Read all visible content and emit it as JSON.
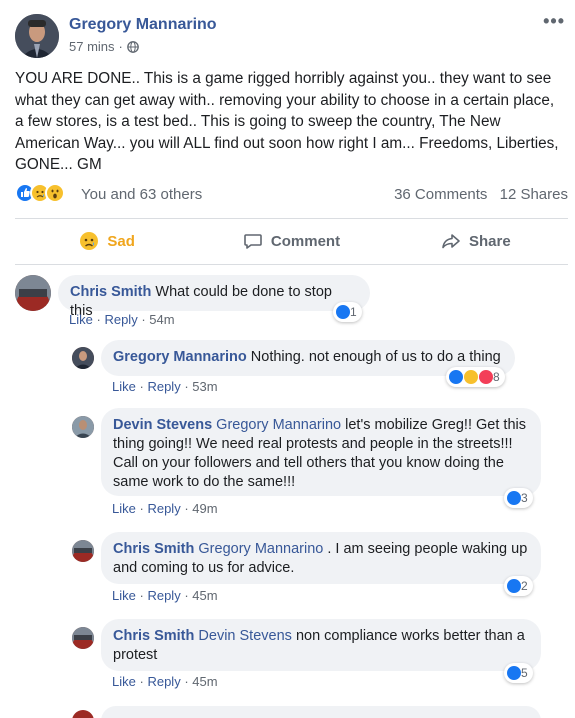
{
  "post": {
    "author": "Gregory Mannarino",
    "time": "57 mins",
    "meta_dot": "·",
    "more": "•••",
    "text": "YOU ARE DONE.. This is a game rigged horribly against you.. they want to see what they can get away with.. removing your ability to choose in a certain place, a few stores, is a test bed.. This is going to sweep the country, The New American Way... you will ALL find out soon how right I am... Freedoms, Liberties, GONE... GM",
    "reactions_text": "You and 63 others",
    "comments_count": "36 Comments",
    "shares_count": "12 Shares"
  },
  "actions": {
    "sad": "Sad",
    "comment": "Comment",
    "share": "Share"
  },
  "comment_links": {
    "like": "Like",
    "dot": "·",
    "reply": "Reply"
  },
  "comments": [
    {
      "name": "Chris Smith",
      "tag": "",
      "text": "What could be done to stop this",
      "time": "54m",
      "reaction_count": "1"
    },
    {
      "name": "Gregory Mannarino",
      "tag": "",
      "text": "Nothing. not enough of us to do a thing",
      "time": "53m",
      "reaction_count": "8"
    },
    {
      "name": "Devin Stevens",
      "tag": "Gregory Mannarino",
      "text": "let's mobilize Greg!! Get this thing going!! We need real protests and people in the streets!!! Call on your followers and tell others that you know doing the same work to do the same!!!",
      "time": "49m",
      "reaction_count": "3"
    },
    {
      "name": "Chris Smith",
      "tag": "Gregory Mannarino",
      "text": ". I am seeing people waking up and coming to us for advice.",
      "time": "45m",
      "reaction_count": "2"
    },
    {
      "name": "Chris Smith",
      "tag": "Devin Stevens",
      "text": "non compliance works better than a protest",
      "time": "45m",
      "reaction_count": "5"
    }
  ],
  "colors": {
    "link": "#385898",
    "like_blue": "#1877f2",
    "sad_yellow": "#f7c02d",
    "love_red": "#f33e58",
    "bubble": "#f0f2f5",
    "muted": "#606770"
  },
  "icons": [
    "globe-icon",
    "like-icon",
    "sad-icon",
    "wow-icon",
    "love-icon",
    "comment-icon",
    "share-icon",
    "more-icon"
  ]
}
